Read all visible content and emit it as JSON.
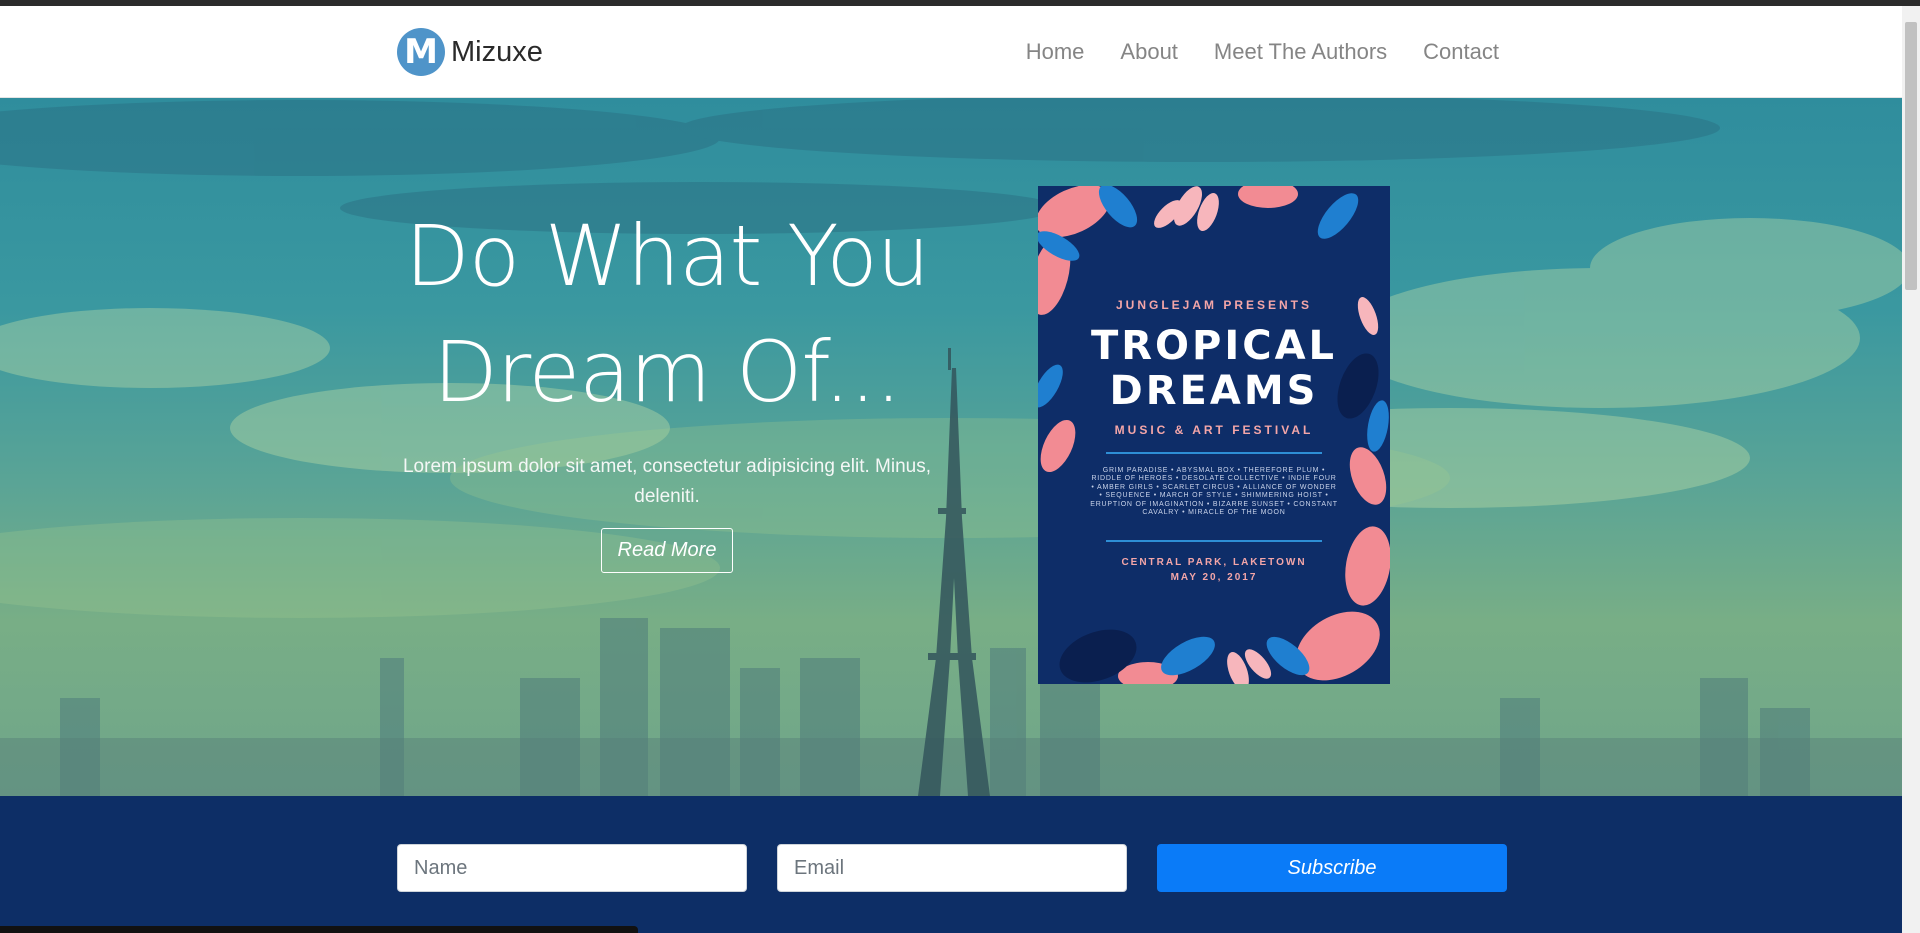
{
  "brand": {
    "logo_letter": "M",
    "name": "Mizuxe"
  },
  "nav": {
    "items": [
      "Home",
      "About",
      "Meet The Authors",
      "Contact"
    ]
  },
  "hero": {
    "title_line1": "Do What You",
    "title_line2": "Dream Of...",
    "subtitle": "Lorem ipsum dolor sit amet, consectetur adipisicing elit. Minus, deleniti.",
    "button_label": "Read More"
  },
  "poster": {
    "presents": "JUNGLEJAM PRESENTS",
    "title_line1": "TROPICAL",
    "title_line2": "DREAMS",
    "subtitle": "MUSIC & ART FESTIVAL",
    "lineup": "GRIM PARADISE • ABYSMAL BOX • THEREFORE PLUM • RIDDLE OF HEROES • DESOLATE COLLECTIVE • INDIE FOUR • AMBER GIRLS • SCARLET CIRCUS • ALLIANCE OF WONDER • SEQUENCE • MARCH OF STYLE • SHIMMERING HOIST • ERUPTION OF IMAGINATION • BIZARRE SUNSET • CONSTANT CAVALRY • MIRACLE OF THE MOON",
    "venue": "CENTRAL PARK, LAKETOWN",
    "date": "MAY 20, 2017"
  },
  "subscribe": {
    "name_placeholder": "Name",
    "email_placeholder": "Email",
    "button_label": "Subscribe"
  },
  "colors": {
    "logo": "#4f94c9",
    "subscribe_bg": "#0d2e66",
    "subscribe_button": "#0a7bf8",
    "poster_bg": "#0e2d68",
    "poster_accent": "#f4a6a8"
  }
}
